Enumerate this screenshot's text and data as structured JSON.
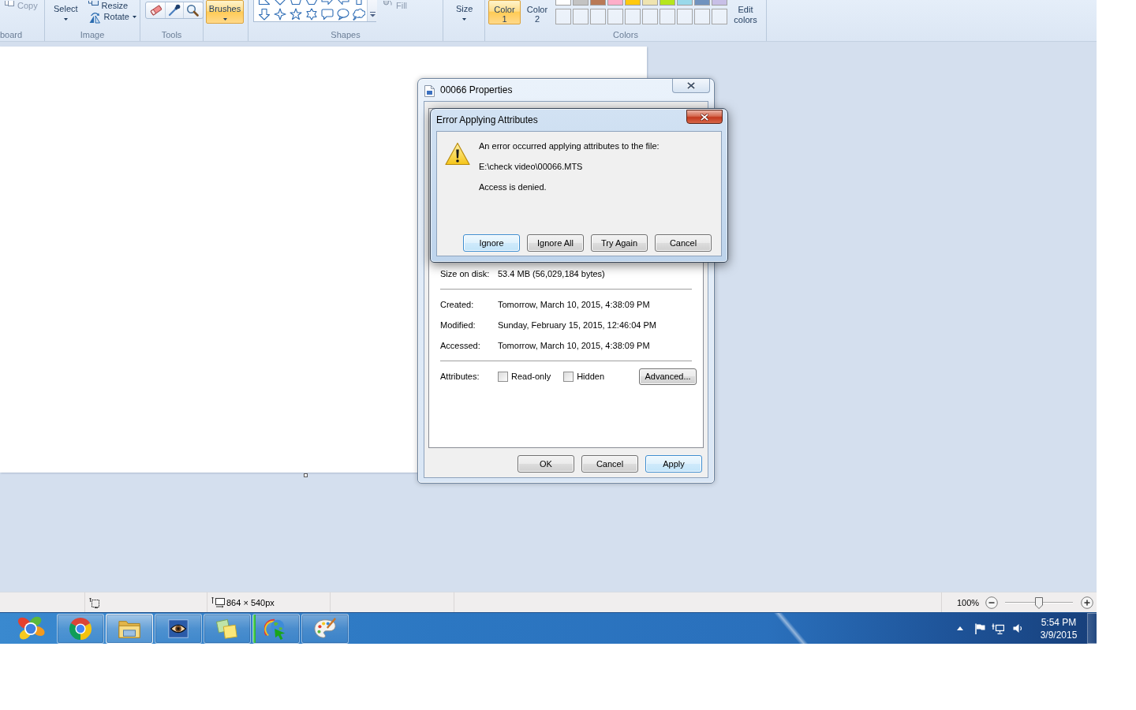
{
  "ribbon": {
    "clipboard": {
      "label": "board",
      "copy": {
        "label": "Copy",
        "disabled": true
      }
    },
    "image": {
      "label": "Image",
      "select": "Select",
      "resize": "Resize",
      "rotate": "Rotate"
    },
    "tools": {
      "label": "Tools"
    },
    "brushes": {
      "label": "Brushes",
      "selected": true
    },
    "shapes": {
      "label": "Shapes",
      "fill": {
        "label": "Fill",
        "disabled": true
      }
    },
    "size": {
      "label": "Size"
    },
    "colors": {
      "label": "Colors",
      "slots": [
        {
          "label": "Color 1",
          "selected": true
        },
        {
          "label": "Color 2",
          "selected": false
        }
      ],
      "palette": [
        {
          "color": "#ffffff"
        },
        {
          "color": "#c3c3c3"
        },
        {
          "color": "#b97a57"
        },
        {
          "color": "#ffaec9"
        },
        {
          "color": "#ffc90e"
        },
        {
          "color": "#efe4b0"
        },
        {
          "color": "#b5e61d"
        },
        {
          "color": "#99d9ea"
        },
        {
          "color": "#7092be"
        },
        {
          "color": "#c8bfe7"
        }
      ],
      "edit": "Edit colors"
    }
  },
  "properties_window": {
    "title": "00066 Properties",
    "active": false,
    "sections": [
      [
        {
          "label": "Size on disk:",
          "value": "53.4 MB (56,029,184 bytes)"
        }
      ],
      [
        {
          "label": "Created:",
          "value": "Tomorrow, March 10, 2015, 4:38:09 PM"
        },
        {
          "label": "Modified:",
          "value": "Sunday, February 15, 2015, 12:46:04 PM"
        },
        {
          "label": "Accessed:",
          "value": "Tomorrow, March 10, 2015, 4:38:09 PM"
        }
      ]
    ],
    "attributes": {
      "label": "Attributes:",
      "options": [
        {
          "label": "Read-only",
          "checked": false
        },
        {
          "label": "Hidden",
          "checked": false
        }
      ],
      "button": "Advanced..."
    },
    "buttons": [
      {
        "label": "OK",
        "default": false
      },
      {
        "label": "Cancel",
        "default": false
      },
      {
        "label": "Apply",
        "default": true
      }
    ]
  },
  "error_dialog": {
    "title": "Error Applying Attributes",
    "active": true,
    "message": [
      "An error occurred applying attributes to the file:",
      "E:\\check video\\00066.MTS",
      "Access is denied."
    ],
    "buttons": [
      {
        "label": "Ignore",
        "default": true
      },
      {
        "label": "Ignore All",
        "default": false
      },
      {
        "label": "Try Again",
        "default": false
      },
      {
        "label": "Cancel",
        "default": false
      }
    ]
  },
  "status_bar": {
    "canvas_size": "864 × 540px",
    "zoom": "100%",
    "zoom_slider": {
      "level": 0.5
    }
  },
  "taskbar": {
    "apps": [
      {
        "kind": "browser",
        "selected": false
      },
      {
        "kind": "folder",
        "selected": true
      },
      {
        "kind": "viewer",
        "selected": false
      },
      {
        "kind": "notes",
        "selected": false
      },
      {
        "kind": "downloader",
        "selected": false,
        "level": 0.06
      },
      {
        "kind": "paint",
        "selected": false
      }
    ],
    "time": "5:54 PM",
    "date": "3/9/2015"
  }
}
